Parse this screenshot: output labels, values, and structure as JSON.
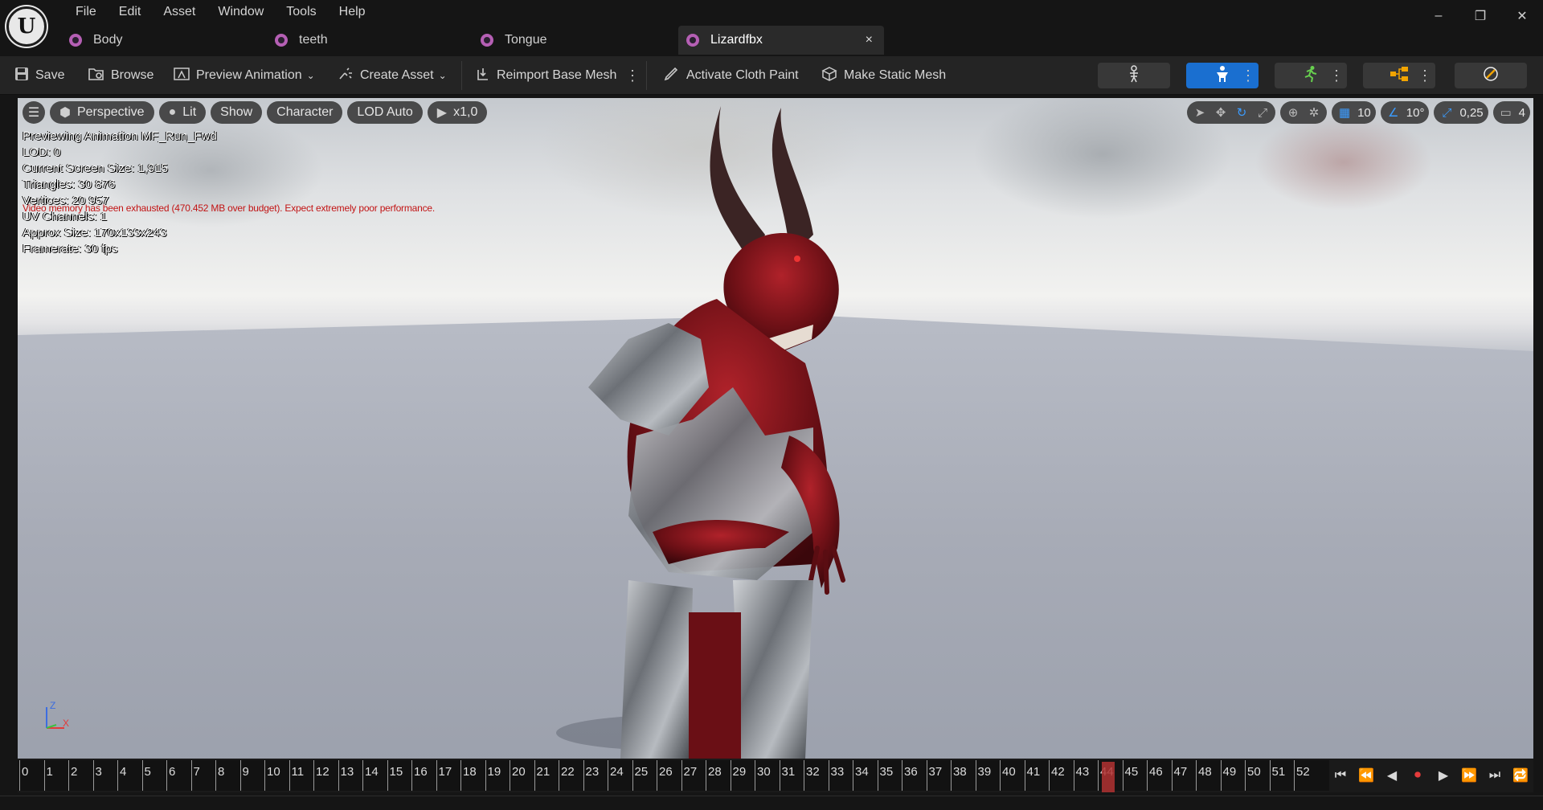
{
  "menu": [
    "File",
    "Edit",
    "Asset",
    "Window",
    "Tools",
    "Help"
  ],
  "window_controls": {
    "minimize": "–",
    "restore": "❐",
    "close": "✕"
  },
  "tabs": [
    {
      "label": "Body",
      "active": false
    },
    {
      "label": "teeth",
      "active": false
    },
    {
      "label": "Tongue",
      "active": false
    },
    {
      "label": "Lizardfbx",
      "active": true
    }
  ],
  "tab_close": "×",
  "toolbar": {
    "save": "Save",
    "browse": "Browse",
    "preview_animation": "Preview Animation",
    "create_asset": "Create Asset",
    "reimport_base_mesh": "Reimport Base Mesh",
    "activate_cloth_paint": "Activate Cloth Paint",
    "make_static_mesh": "Make Static Mesh"
  },
  "viewport": {
    "perspective": "Perspective",
    "lit": "Lit",
    "show": "Show",
    "character": "Character",
    "lod": "LOD Auto",
    "play_rate": "x1,0",
    "grid_snap": "10",
    "rotation_snap": "10°",
    "scale_snap": "0,25",
    "camera_speed": "4",
    "stats": [
      "Previewing Animation MF_Run_Fwd",
      "LOD: 0",
      "Current Screen Size: 1,915",
      "Triangles: 30 876",
      "Vertices: 20 957",
      "UV Channels: 1",
      "Approx Size: 170x133x243",
      "Framerate: 30 fps"
    ],
    "warning": "Video memory has been exhausted (470.452 MB over budget). Expect extremely poor performance.",
    "axis_z": "Z",
    "axis_x": "X"
  },
  "timeline": {
    "frames": [
      "0",
      "1",
      "2",
      "3",
      "4",
      "5",
      "6",
      "7",
      "8",
      "9",
      "10",
      "11",
      "12",
      "13",
      "14",
      "15",
      "16",
      "17",
      "18",
      "19",
      "20",
      "21",
      "22",
      "23",
      "24",
      "25",
      "26",
      "27",
      "28",
      "29",
      "30",
      "31",
      "32",
      "33",
      "34",
      "35",
      "36",
      "37",
      "38",
      "39",
      "40",
      "41",
      "42",
      "43",
      "44",
      "45",
      "46",
      "47",
      "48",
      "49",
      "50",
      "51",
      "52"
    ],
    "current_frame": 44
  },
  "colors": {
    "accent_blue": "#1a6fd0",
    "playhead": "#b23333",
    "warning": "#c21414",
    "asset_icon": "#b55fb4"
  }
}
